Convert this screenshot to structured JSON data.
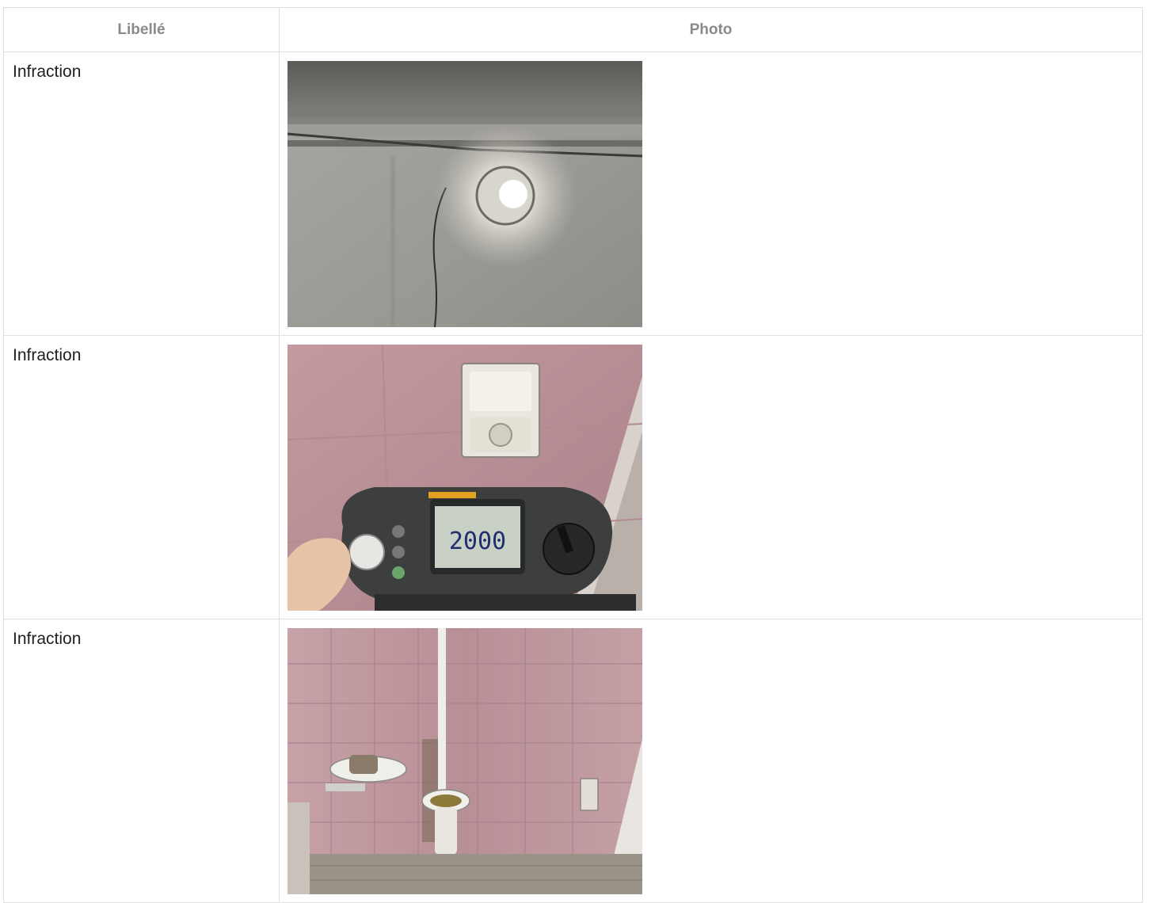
{
  "table": {
    "headers": {
      "label": "Libellé",
      "photo": "Photo"
    },
    "rows": [
      {
        "label": "Infraction",
        "photo_icon": "ceiling-lamp-photo"
      },
      {
        "label": "Infraction",
        "photo_icon": "multimeter-photo",
        "meter_reading": "2000"
      },
      {
        "label": "Infraction",
        "photo_icon": "bathroom-photo"
      }
    ]
  }
}
